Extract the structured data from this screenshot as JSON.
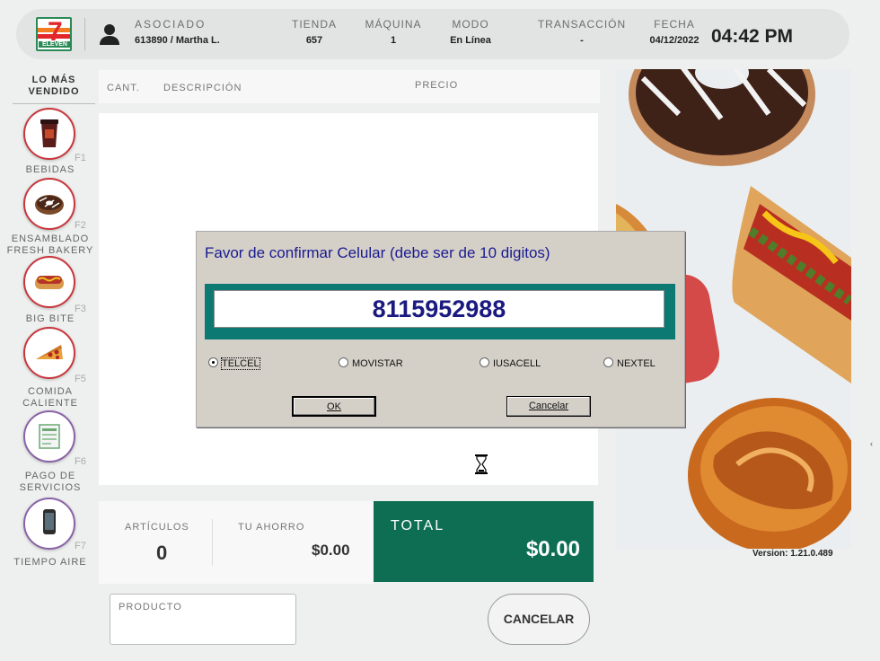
{
  "header": {
    "logo_text": "ELEVEN",
    "logo_number": "7",
    "associate_label": "ASOCIADO",
    "associate_value": "613890 / Martha L.",
    "store_label": "TIENDA",
    "store_value": "657",
    "machine_label": "MÁQUINA",
    "machine_value": "1",
    "mode_label": "MODO",
    "mode_value": "En Línea",
    "transaction_label": "TRANSACCIÓN",
    "transaction_value": "-",
    "date_label": "FECHA",
    "date_value": "04/12/2022",
    "time_value": "04:42 PM"
  },
  "sidebar": {
    "title": "LO MÁS VENDIDO",
    "items": [
      {
        "label": "BEBIDAS",
        "key": "F1",
        "icon": "drink-cup-icon"
      },
      {
        "label": "ENSAMBLADO FRESH BAKERY",
        "key": "F2",
        "icon": "donut-icon"
      },
      {
        "label": "BIG BITE",
        "key": "F3",
        "icon": "hotdog-icon"
      },
      {
        "label": "COMIDA CALIENTE",
        "key": "F5",
        "icon": "pizza-slice-icon"
      },
      {
        "label": "PAGO DE SERVICIOS",
        "key": "F6",
        "icon": "receipt-icon"
      },
      {
        "label": "TIEMPO AIRE",
        "key": "F7",
        "icon": "mobile-phone-icon"
      }
    ]
  },
  "table": {
    "col_qty": "CANT.",
    "col_desc": "DESCRIPCIÓN",
    "col_price": "PRECIO"
  },
  "summary": {
    "items_label": "ARTÍCULOS",
    "items_value": "0",
    "savings_label": "TU AHORRO",
    "savings_value": "$0.00",
    "total_label": "TOTAL",
    "total_value": "$0.00"
  },
  "product": {
    "label": "PRODUCTO"
  },
  "cancel_label": "CANCELAR",
  "version": "Version: 1.21.0.489",
  "dialog": {
    "title": "Favor de confirmar Celular (debe ser de 10 digitos)",
    "phone_number": "8115952988",
    "carriers": [
      {
        "label": "TELCEL",
        "selected": true
      },
      {
        "label": "MOVISTAR",
        "selected": false
      },
      {
        "label": "IUSACELL",
        "selected": false
      },
      {
        "label": "NEXTEL",
        "selected": false
      }
    ],
    "ok_label": "OK",
    "cancel_label": "Cancelar"
  },
  "colors": {
    "total_bg": "#0e6e53",
    "dialog_bg": "#d4d0c8",
    "number_frame": "#0c7a72",
    "number_text": "#1a1a80",
    "category_ring": "#c8373d"
  }
}
